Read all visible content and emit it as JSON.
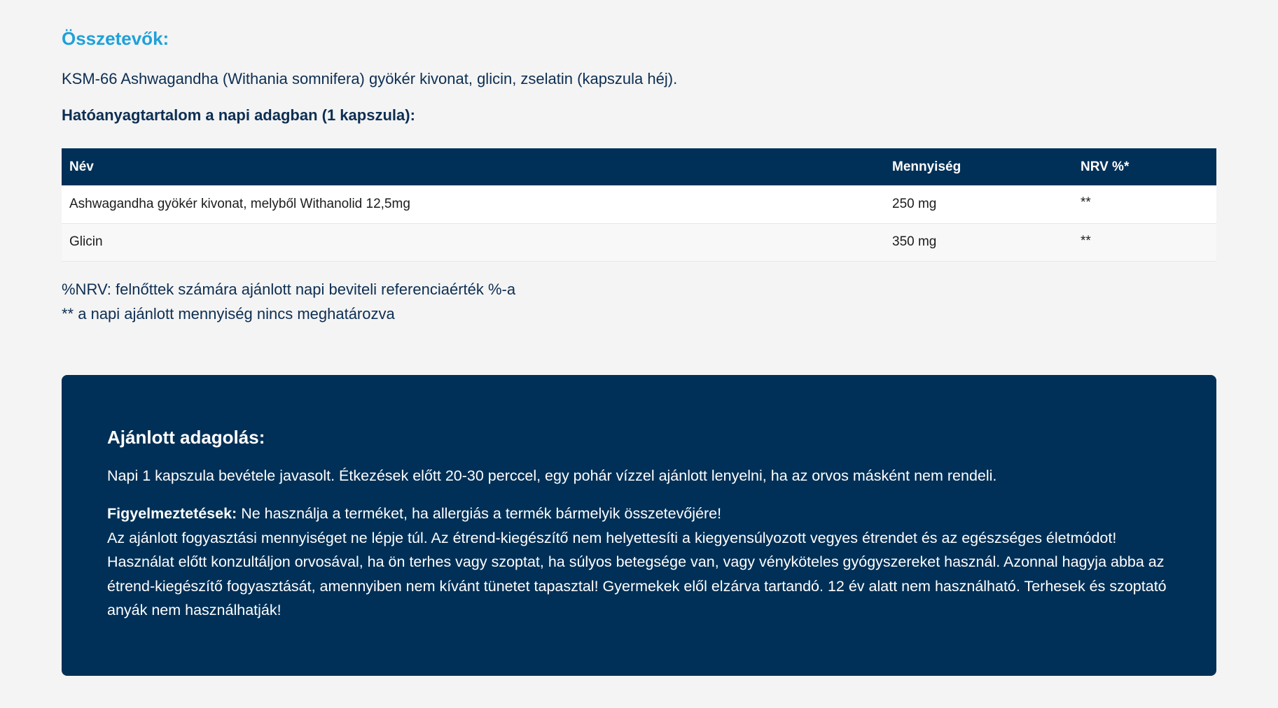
{
  "ingredients": {
    "title": "Összetevők:",
    "text": "KSM-66 Ashwagandha (Withania somnifera) gyökér kivonat, glicin, zselatin (kapszula héj)."
  },
  "content_title": "Hatóanyagtartalom a napi adagban (1 kapszula):",
  "table": {
    "headers": {
      "name": "Név",
      "quantity": "Mennyiség",
      "nrv": "NRV %*"
    },
    "rows": [
      {
        "name": "Ashwagandha gyökér kivonat, melyből Withanolid 12,5mg",
        "quantity": "250 mg",
        "nrv": "**"
      },
      {
        "name": "Glicin",
        "quantity": "350 mg",
        "nrv": "**"
      }
    ]
  },
  "footnotes": {
    "nrv": "%NRV: felnőttek számára ajánlott napi beviteli referenciaérték %-a",
    "undefined": "** a napi ajánlott mennyiség nincs meghatározva"
  },
  "dosage": {
    "title": "Ajánlott adagolás:",
    "text": "Napi 1 kapszula bevétele javasolt. Étkezések előtt 20-30 perccel, egy pohár vízzel ajánlott lenyelni, ha az orvos másként nem rendeli.",
    "warning_label": "Figyelmeztetések:",
    "warning_first": " Ne használja a terméket, ha allergiás a termék bármelyik összetevőjére!",
    "warning_second": "Az ajánlott fogyasztási mennyiséget ne lépje túl. Az étrend-kiegészítő nem helyettesíti a kiegyensúlyozott vegyes étrendet és az egészséges életmódot!",
    "warning_third": "Használat előtt konzultáljon orvosával, ha ön terhes vagy szoptat, ha súlyos betegsége van, vagy vényköteles gyógyszereket használ. Azonnal hagyja abba az étrend-kiegészítő fogyasztását, amennyiben nem kívánt tünetet tapasztal! Gyermekek elől elzárva tartandó. 12 év alatt nem használható. Terhesek és szoptató anyák nem használhatják!"
  },
  "colors": {
    "accent": "#1ea1d9",
    "navy": "#003057",
    "background": "#f4f4f4"
  }
}
